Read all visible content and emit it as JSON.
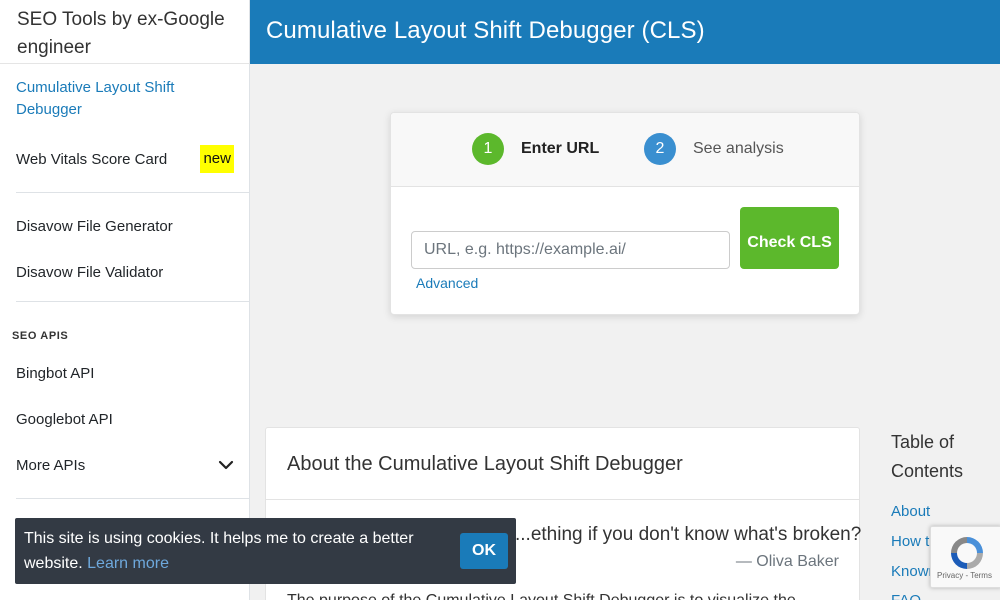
{
  "sidebar": {
    "brand": "SEO Tools by ex-Google engineer",
    "items_top": [
      {
        "label": "Cumulative Layout Shift Debugger"
      },
      {
        "label": "Web Vitals Score Card",
        "badge": "new"
      }
    ],
    "items_disavow": [
      {
        "label": "Disavow File Generator"
      },
      {
        "label": "Disavow File Validator"
      }
    ],
    "apis_section_title": "SEO APIS",
    "items_apis": [
      {
        "label": "Bingbot API"
      },
      {
        "label": "Googlebot API"
      },
      {
        "label": "More APIs"
      }
    ]
  },
  "header": {
    "title": "Cumulative Layout Shift Debugger (CLS)"
  },
  "stepper": {
    "step1_number": "1",
    "step1_label": "Enter URL",
    "step2_number": "2",
    "step2_label": "See analysis",
    "url_placeholder": "URL, e.g. https://example.ai/",
    "url_value": "",
    "advanced_link": "Advanced",
    "check_button": "Check CLS"
  },
  "about": {
    "title": "About the Cumulative Layout Shift Debugger",
    "quote": "...ething if you don't know what's broken?",
    "quote_author": "— Oliva Baker",
    "body_start": "The purpose of the Cumulative Layout Shift Debugger is to visualize the"
  },
  "toc": {
    "title": "Table of Contents",
    "links": [
      "About",
      "How to fix",
      "Known Issues",
      "FAQ"
    ]
  },
  "recaptcha": {
    "footer": "Privacy - Terms"
  },
  "cookie": {
    "message": "This site is using cookies. It helps me to create a better website.",
    "learn_more": "Learn more",
    "ok_button": "OK"
  },
  "colors": {
    "primary": "#1a7bb9",
    "success": "#5cb82c",
    "step2": "#3a8fd0",
    "badge": "#ffff00",
    "cookie_bg": "#333a44"
  }
}
